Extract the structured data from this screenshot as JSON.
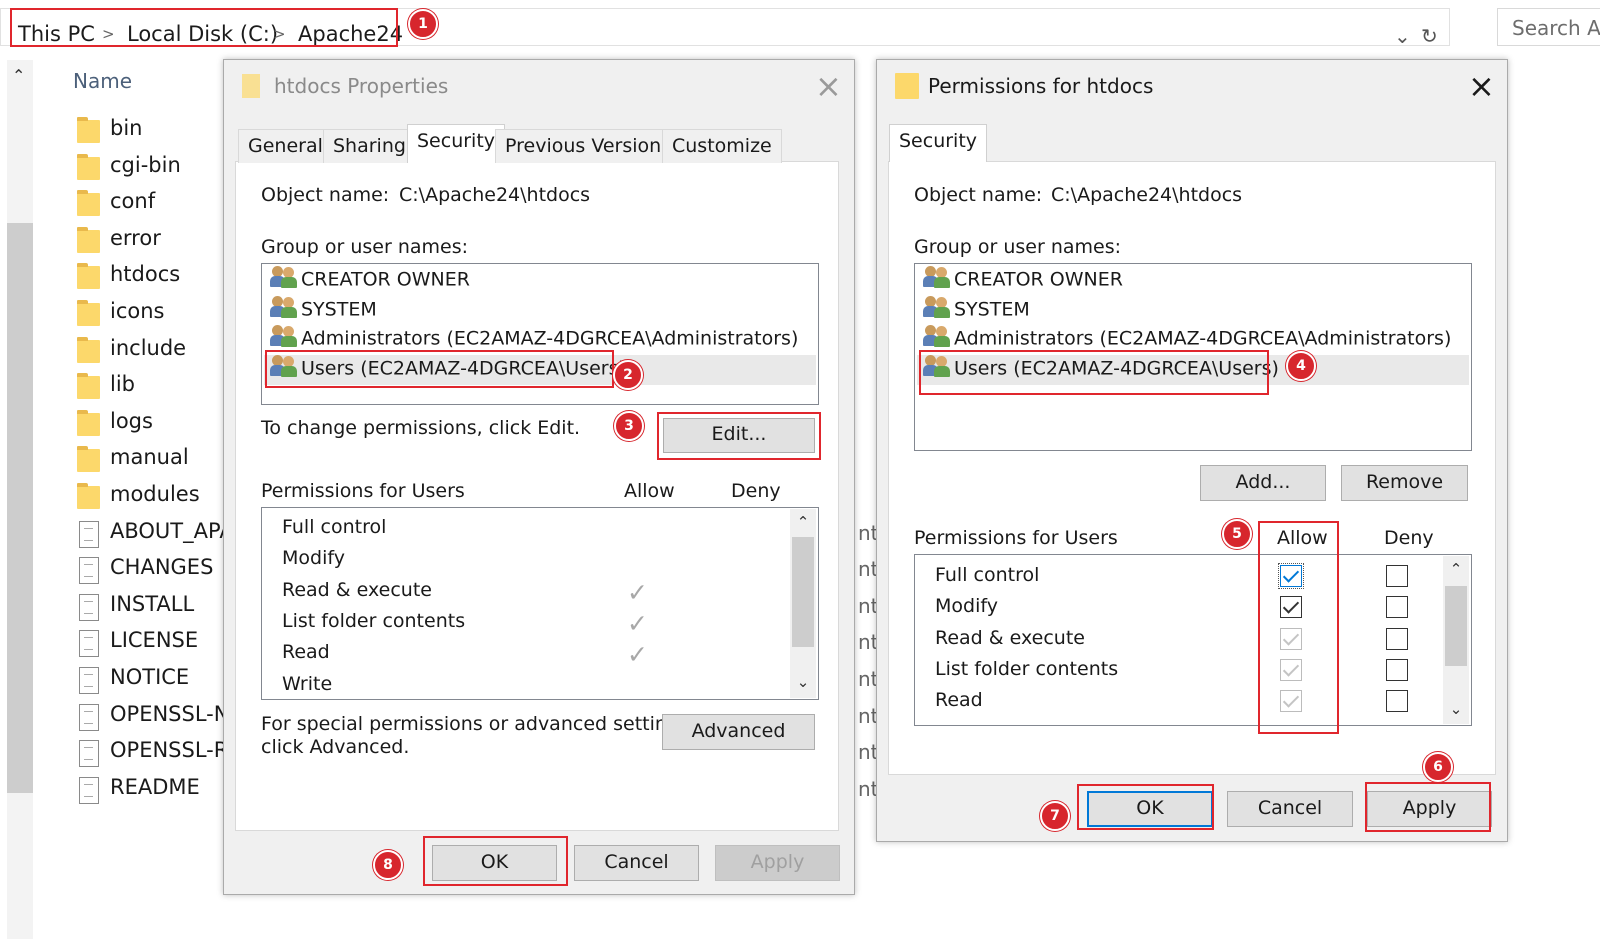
{
  "explorer": {
    "breadcrumb": [
      "This PC",
      "Local Disk (C:)",
      "Apache24"
    ],
    "separator": ">",
    "search_placeholder": "Search Ap",
    "column_name": "Name",
    "folders": [
      "bin",
      "cgi-bin",
      "conf",
      "error",
      "htdocs",
      "icons",
      "include",
      "lib",
      "logs",
      "manual",
      "modules"
    ],
    "files": [
      "ABOUT_APA",
      "CHANGES",
      "INSTALL",
      "LICENSE",
      "NOTICE",
      "OPENSSL-NE",
      "OPENSSL-RE",
      "README"
    ],
    "type_fragment": "nt"
  },
  "properties": {
    "title": "htdocs Properties",
    "tabs": [
      "General",
      "Sharing",
      "Security",
      "Previous Versions",
      "Customize"
    ],
    "active_tab": "Security",
    "object_label": "Object name:",
    "object_value": "C:\\Apache24\\htdocs",
    "group_label": "Group or user names:",
    "users": [
      "CREATOR OWNER",
      "SYSTEM",
      "Administrators (EC2AMAZ-4DGRCEA\\Administrators)",
      "Users (EC2AMAZ-4DGRCEA\\Users)"
    ],
    "change_text": "To change permissions, click Edit.",
    "edit_button": "Edit...",
    "perms_for": "Permissions for Users",
    "allow_header": "Allow",
    "deny_header": "Deny",
    "permissions": [
      "Full control",
      "Modify",
      "Read & execute",
      "List folder contents",
      "Read",
      "Write"
    ],
    "allowed": [
      "Read & execute",
      "List folder contents",
      "Read"
    ],
    "special_text_1": "For special permissions or advanced settings,",
    "special_text_2": "click Advanced.",
    "advanced_button": "Advanced",
    "ok_button": "OK",
    "cancel_button": "Cancel",
    "apply_button": "Apply"
  },
  "permissions_dialog": {
    "title": "Permissions for htdocs",
    "tab": "Security",
    "object_label": "Object name:",
    "object_value": "C:\\Apache24\\htdocs",
    "group_label": "Group or user names:",
    "users": [
      "CREATOR OWNER",
      "SYSTEM",
      "Administrators (EC2AMAZ-4DGRCEA\\Administrators)",
      "Users (EC2AMAZ-4DGRCEA\\Users)"
    ],
    "add_button": "Add...",
    "remove_button": "Remove",
    "perms_for": "Permissions for Users",
    "allow_header": "Allow",
    "deny_header": "Deny",
    "permissions": [
      "Full control",
      "Modify",
      "Read & execute",
      "List folder contents",
      "Read"
    ],
    "ok_button": "OK",
    "cancel_button": "Cancel",
    "apply_button": "Apply"
  },
  "annotations": [
    "1",
    "2",
    "3",
    "4",
    "5",
    "6",
    "7",
    "8"
  ],
  "colors": {
    "highlight": "#e0262d",
    "badge": "#d7262d",
    "accent": "#0078d7"
  }
}
